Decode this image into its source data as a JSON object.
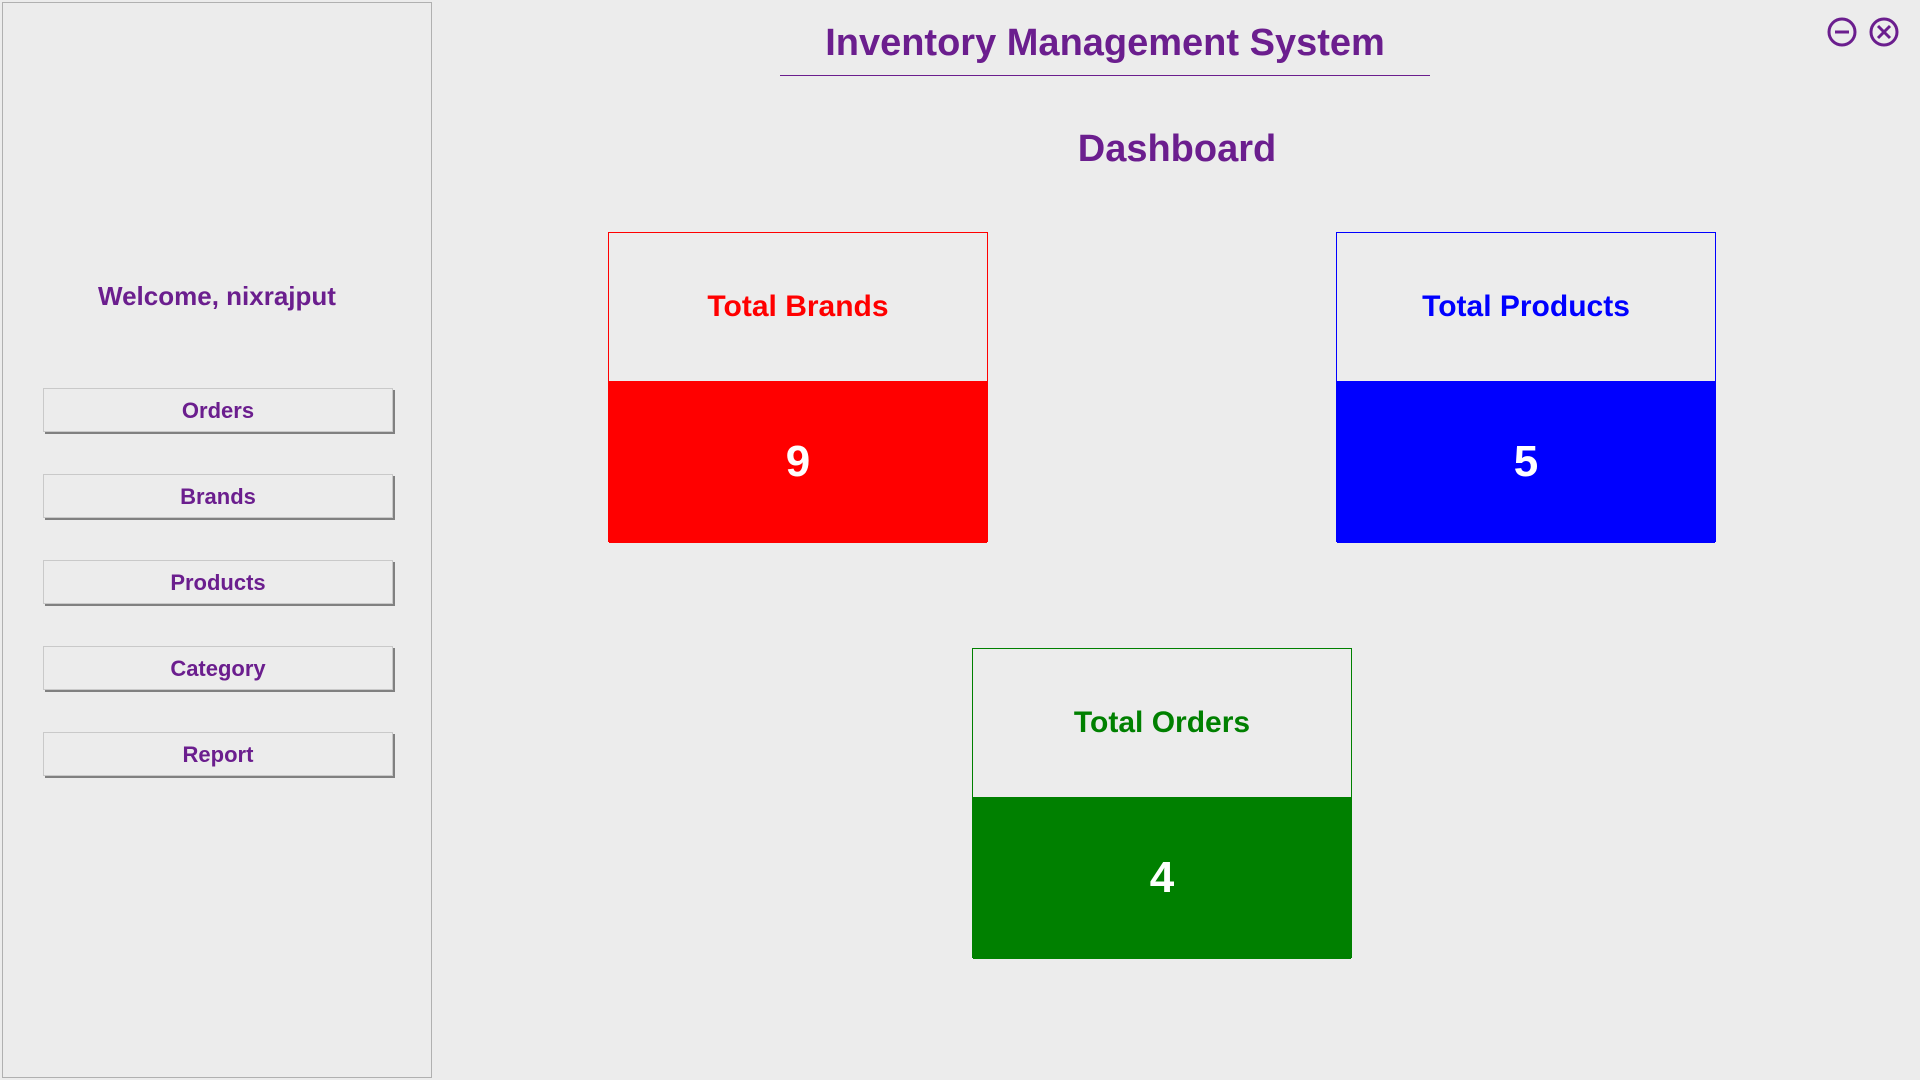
{
  "header": {
    "app_title": "Inventory Management System",
    "page_title": "Dashboard"
  },
  "sidebar": {
    "welcome": "Welcome, nixrajput",
    "nav": [
      {
        "label": "Orders"
      },
      {
        "label": "Brands"
      },
      {
        "label": "Products"
      },
      {
        "label": "Category"
      },
      {
        "label": "Report"
      }
    ]
  },
  "dashboard": {
    "brands": {
      "label": "Total Brands",
      "value": "9"
    },
    "products": {
      "label": "Total Products",
      "value": "5"
    },
    "orders": {
      "label": "Total Orders",
      "value": "4"
    }
  },
  "colors": {
    "accent": "#6b1e8e",
    "brands": "#ff0000",
    "products": "#0000ff",
    "orders": "#008000"
  }
}
